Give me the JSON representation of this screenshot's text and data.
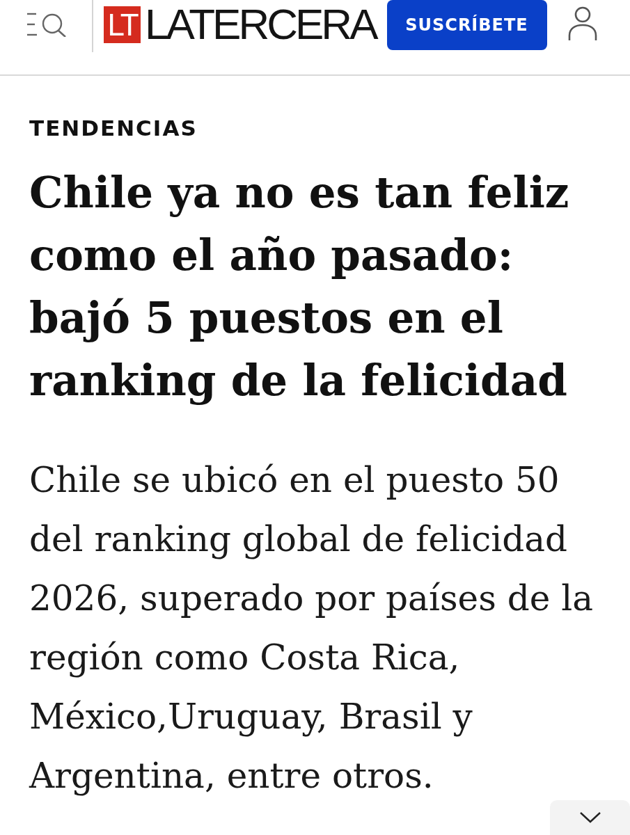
{
  "header": {
    "logo": {
      "badge": "LT",
      "wordmark": "LATERCERA"
    },
    "subscribe_button": "SUSCRÍBETE"
  },
  "article": {
    "section": "TENDENCIAS",
    "headline": "Chile ya no es tan feliz como el año pasado: bajó 5 puestos en el ranking de la felicidad",
    "lead": "Chile se ubicó en el puesto 50 del ranking global de felicidad 2026, superado por países de la región como Costa Rica, México,Uruguay, Brasil y Argentina, entre otros."
  }
}
